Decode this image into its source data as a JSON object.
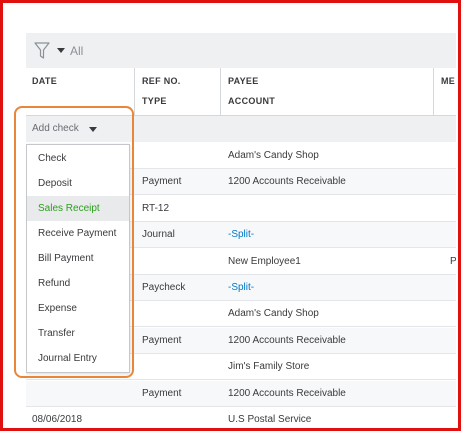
{
  "filter": {
    "label": "All"
  },
  "headers": {
    "date": "DATE",
    "ref_no": "REF NO.",
    "type": "TYPE",
    "payee": "PAYEE",
    "account": "ACCOUNT",
    "memo": "ME"
  },
  "add": {
    "label": "Add check"
  },
  "menu": [
    "Check",
    "Deposit",
    "Sales Receipt",
    "Receive Payment",
    "Bill Payment",
    "Refund",
    "Expense",
    "Transfer",
    "Journal Entry"
  ],
  "menu_selected": "Sales Receipt",
  "rows": [
    {
      "date": "",
      "col2": "",
      "col3": "Adam's Candy Shop",
      "col4": ""
    },
    {
      "date": "",
      "col2": "Payment",
      "col3": "1200 Accounts Receivable",
      "col4": ""
    },
    {
      "date": "",
      "col2": "RT-12",
      "col3": "",
      "col4": ""
    },
    {
      "date": "",
      "col2": "Journal",
      "col3": "-Split-",
      "col4": ""
    },
    {
      "date": "",
      "col2": "",
      "col3": "New Employee1",
      "col4": "P"
    },
    {
      "date": "",
      "col2": "Paycheck",
      "col3": "-Split-",
      "col4": ""
    },
    {
      "date": "",
      "col2": "",
      "col3": "Adam's Candy Shop",
      "col4": ""
    },
    {
      "date": "",
      "col2": "Payment",
      "col3": "1200 Accounts Receivable",
      "col4": ""
    },
    {
      "date": "",
      "col2": "",
      "col3": "Jim's Family Store",
      "col4": ""
    },
    {
      "date": "",
      "col2": "Payment",
      "col3": "1200 Accounts Receivable",
      "col4": ""
    },
    {
      "date": "08/06/2018",
      "col2": "",
      "col3": "U.S Postal Service",
      "col4": ""
    }
  ],
  "colors": {
    "highlight_border": "#e8873a",
    "frame_border": "#e0100e",
    "link": "#0077c5",
    "selected_text": "#2ca01c"
  },
  "icons": {
    "filter": "funnel-icon",
    "caret": "caret-down-icon"
  }
}
